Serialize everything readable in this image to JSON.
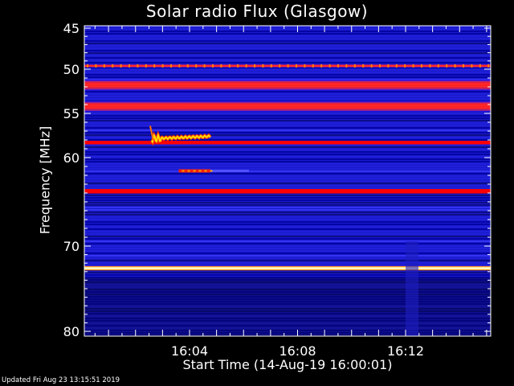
{
  "chart_data": {
    "type": "heatmap",
    "title": "Solar radio Flux (Glasgow)",
    "xlabel": "Start Time (14-Aug-19 16:00:01)",
    "ylabel": "Frequency [MHz]",
    "footer": "Updated Fri Aug 23 13:15:51 2019",
    "x_range_minutes": [
      0,
      15
    ],
    "x_ticks": [
      {
        "label": "16:04",
        "minute": 4
      },
      {
        "label": "16:08",
        "minute": 8
      },
      {
        "label": "16:12",
        "minute": 12
      }
    ],
    "ylim": [
      45,
      80
    ],
    "y_axis_inverted": true,
    "y_ticks": [
      45,
      50,
      55,
      60,
      70,
      80
    ],
    "colormap": [
      "#00007f",
      "#0000ff",
      "#7f00ff",
      "#ff0000",
      "#ffff00",
      "#ffffff"
    ],
    "bands": [
      {
        "mhz": 49.6,
        "level": 0.85,
        "width": 0.4,
        "dotted": true
      },
      {
        "mhz": 51.8,
        "level": 0.7,
        "width": 1.2
      },
      {
        "mhz": 54.2,
        "level": 0.68,
        "width": 1.2
      },
      {
        "mhz": 58.3,
        "level": 0.5,
        "width": 0.4
      },
      {
        "mhz": 63.8,
        "level": 0.55,
        "width": 0.5
      },
      {
        "mhz": 72.6,
        "level": 1.0,
        "width": 0.5
      }
    ],
    "bursts": [
      {
        "start_min": 2.6,
        "end_min": 4.8,
        "mhz": 57.5,
        "level": 0.9
      },
      {
        "start_min": 3.6,
        "end_min": 6.2,
        "mhz": 61.5,
        "level": 0.7
      }
    ]
  }
}
